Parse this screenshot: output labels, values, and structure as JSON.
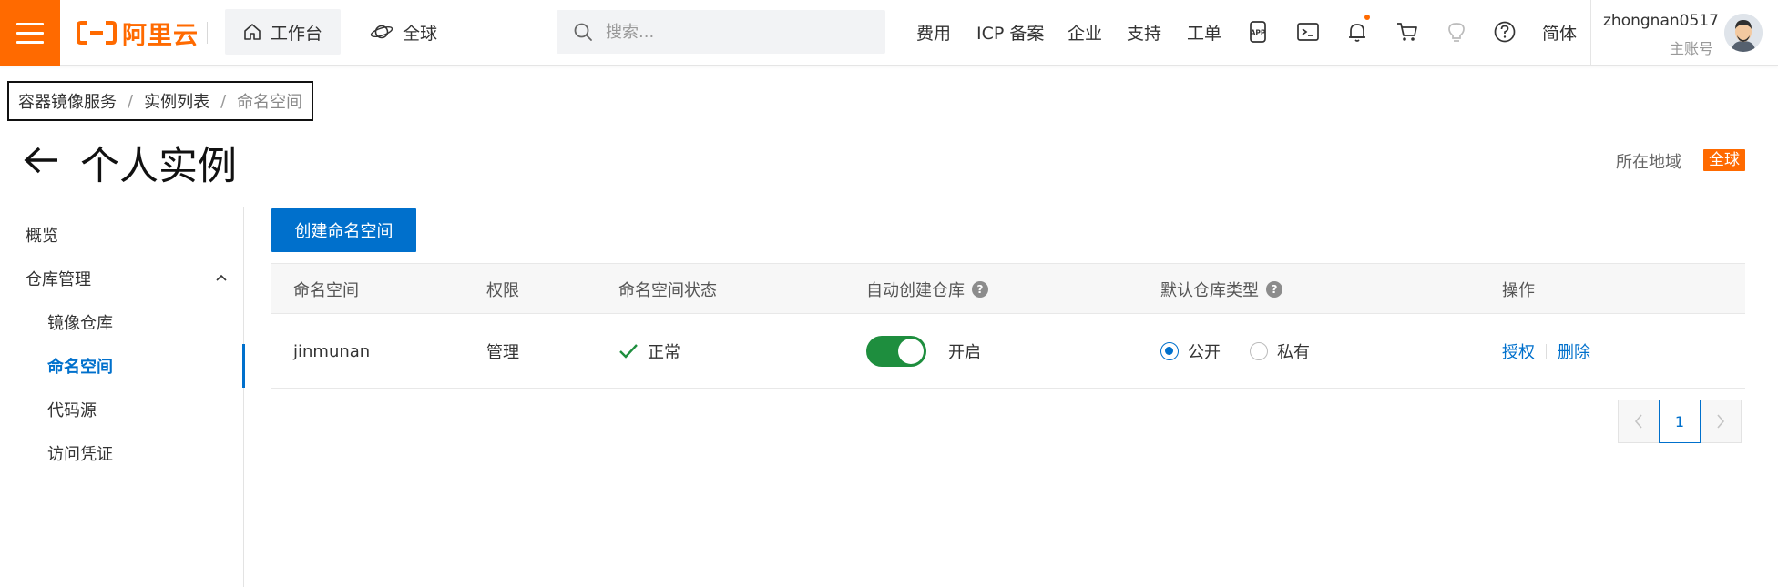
{
  "topbar": {
    "logo_text": "阿里云",
    "workbench_label": "工作台",
    "global_label": "全球",
    "search_placeholder": "搜索...",
    "links": {
      "billing": "费用",
      "icp": "ICP 备案",
      "enterprise": "企业",
      "support": "支持",
      "ticket": "工单",
      "language": "简体"
    },
    "icons": [
      "app-icon",
      "terminal-icon",
      "bell-icon",
      "cart-icon",
      "lightbulb-icon",
      "help-circle-icon"
    ],
    "user": {
      "name": "zhongnan0517",
      "role": "主账号"
    },
    "accent_color": "#ff6a00"
  },
  "breadcrumb": {
    "items": [
      "容器镜像服务",
      "实例列表",
      "命名空间"
    ],
    "separator": "/"
  },
  "page": {
    "title": "个人实例",
    "region_label": "所在地域",
    "region_value": "全球"
  },
  "sidebar": {
    "overview": "概览",
    "repo_mgmt": "仓库管理",
    "image_repo": "镜像仓库",
    "namespace": "命名空间",
    "code_source": "代码源",
    "access_credential": "访问凭证",
    "active_item": "命名空间"
  },
  "main": {
    "create_button": "创建命名空间",
    "columns": {
      "namespace": "命名空间",
      "permission": "权限",
      "status": "命名空间状态",
      "auto_create": "自动创建仓库",
      "default_type": "默认仓库类型",
      "actions": "操作"
    },
    "rows": [
      {
        "namespace": "jinmunan",
        "permission": "管理",
        "status": "正常",
        "auto_create_on": true,
        "auto_create_label": "开启",
        "type_public": "公开",
        "type_private": "私有",
        "selected_type": "公开",
        "action_authorize": "授权",
        "action_delete": "删除"
      }
    ],
    "pagination": {
      "current_page": "1"
    }
  }
}
